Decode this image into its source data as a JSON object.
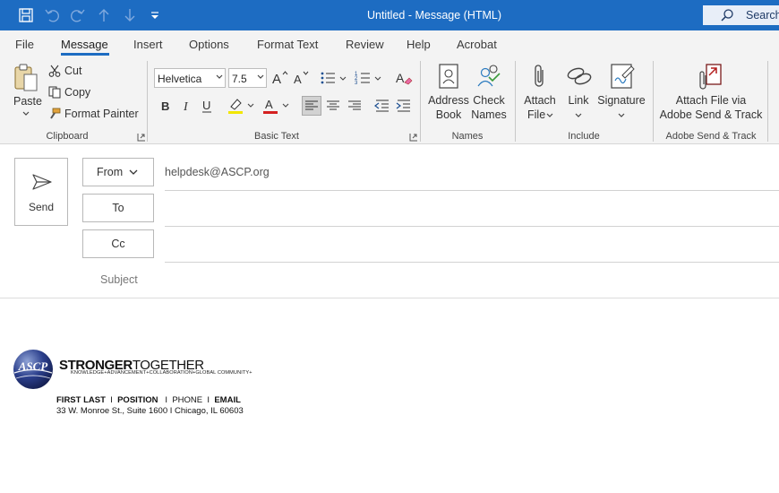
{
  "window": {
    "title": "Untitled  -  Message (HTML)",
    "search_label": "Search"
  },
  "tabs": [
    "File",
    "Message",
    "Insert",
    "Options",
    "Format Text",
    "Review",
    "Help",
    "Acrobat"
  ],
  "active_tab": "Message",
  "ribbon": {
    "clipboard": {
      "paste": "Paste",
      "cut": "Cut",
      "copy": "Copy",
      "format_painter": "Format Painter",
      "group_label": "Clipboard"
    },
    "basic_text": {
      "font_name": "Helvetica",
      "font_size": "7.5",
      "group_label": "Basic Text",
      "highlight_color": "#f2e600",
      "font_color": "#d42020"
    },
    "names": {
      "address_book_l1": "Address",
      "address_book_l2": "Book",
      "check_names_l1": "Check",
      "check_names_l2": "Names",
      "group_label": "Names"
    },
    "include": {
      "attach_file_l1": "Attach",
      "attach_file_l2": "File",
      "link": "Link",
      "signature": "Signature",
      "group_label": "Include"
    },
    "adobe": {
      "attach_l1": "Attach File via",
      "attach_l2": "Adobe Send & Track",
      "group_label": "Adobe Send & Track"
    }
  },
  "compose": {
    "send_label": "Send",
    "from_label": "From",
    "from_value": "helpdesk@ASCP.org",
    "to_label": "To",
    "cc_label": "Cc",
    "subject_label": "Subject"
  },
  "signature": {
    "logo_text": "ASCP",
    "tagline_bold": "STRONGER",
    "tagline_rest": "TOGETHER",
    "subline": "KNOWLEDGE+ADVANCEMENT+COLLABORATION+GLOBAL COMMUNITY+",
    "line1_name": "FIRST LAST",
    "line1_sep1": "  I  ",
    "line1_position": "POSITION",
    "line1_sep2": "   I  ",
    "line1_phone": "PHONE",
    "line1_sep3": "  I  ",
    "line1_email": "EMAIL",
    "line2": "33 W. Monroe St., Suite 1600  I  Chicago, IL 60603"
  },
  "colors": {
    "titlebar": "#1d6cc2",
    "ribbon": "#f3f3f3",
    "accent": "#1d6cc2"
  }
}
